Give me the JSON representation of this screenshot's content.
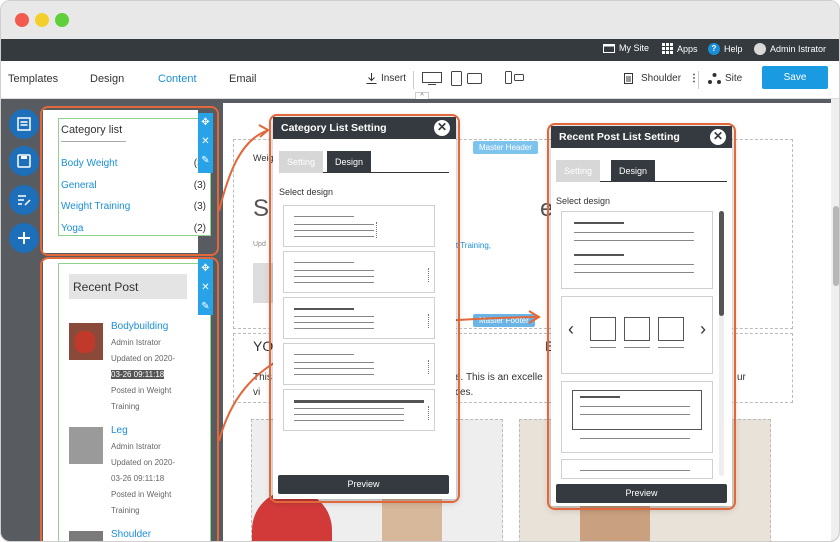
{
  "topbar": {
    "my_site": "My Site",
    "apps": "Apps",
    "help": "Help",
    "user": "Admin Istrator"
  },
  "toolbar": {
    "tabs": [
      "Templates",
      "Design",
      "Content",
      "Email"
    ],
    "active_tab": "Content",
    "insert": "Insert",
    "shoulder": "Shoulder",
    "site": "Site",
    "save": "Save"
  },
  "category_widget": {
    "title": "Category list",
    "items": [
      {
        "label": "Body Weight",
        "count": "(3)"
      },
      {
        "label": "General",
        "count": "(3)"
      },
      {
        "label": "Weight Training",
        "count": "(3)"
      },
      {
        "label": "Yoga",
        "count": "(2)"
      }
    ]
  },
  "recent_post_widget": {
    "title": "Recent Post",
    "posts": [
      {
        "title": "Bodybuilding",
        "author": "Admin Istrator",
        "updated_prefix": "Updated on 2020-",
        "updated_date": "03-26 09:11:18",
        "posted": "Posted in Weight",
        "posted2": "Training"
      },
      {
        "title": "Leg",
        "author": "Admin Istrator",
        "updated_prefix": "Updated on 2020-",
        "updated_date": "03-26 09:11:18",
        "posted": "Posted in Weight",
        "posted2": "Training"
      },
      {
        "title": "Shoulder"
      }
    ]
  },
  "category_dialog": {
    "title": "Category List Setting",
    "tab_setting": "Setting",
    "tab_design": "Design",
    "select_design": "Select design",
    "preview": "Preview"
  },
  "recent_dialog": {
    "title": "Recent Post List Setting",
    "tab_setting": "Setting",
    "tab_design": "Design",
    "select_design": "Select design",
    "preview": "Preview"
  },
  "page": {
    "weig": "Weig",
    "big_s": "S",
    "big_e": "e",
    "updated": "Upd",
    "ht_training": "ght Training,",
    "master_header": "Master Header",
    "yo": "YO",
    "e_letter": "E",
    "this": "This",
    "body_text": "e. This is an excelle",
    "body_end": "ur",
    "vi": "vi",
    "ces": "ces.",
    "master_footer": "Master Footer"
  },
  "colors": {
    "accent": "#1a9ae0",
    "highlight": "#e2673a",
    "dark": "#343a40"
  }
}
